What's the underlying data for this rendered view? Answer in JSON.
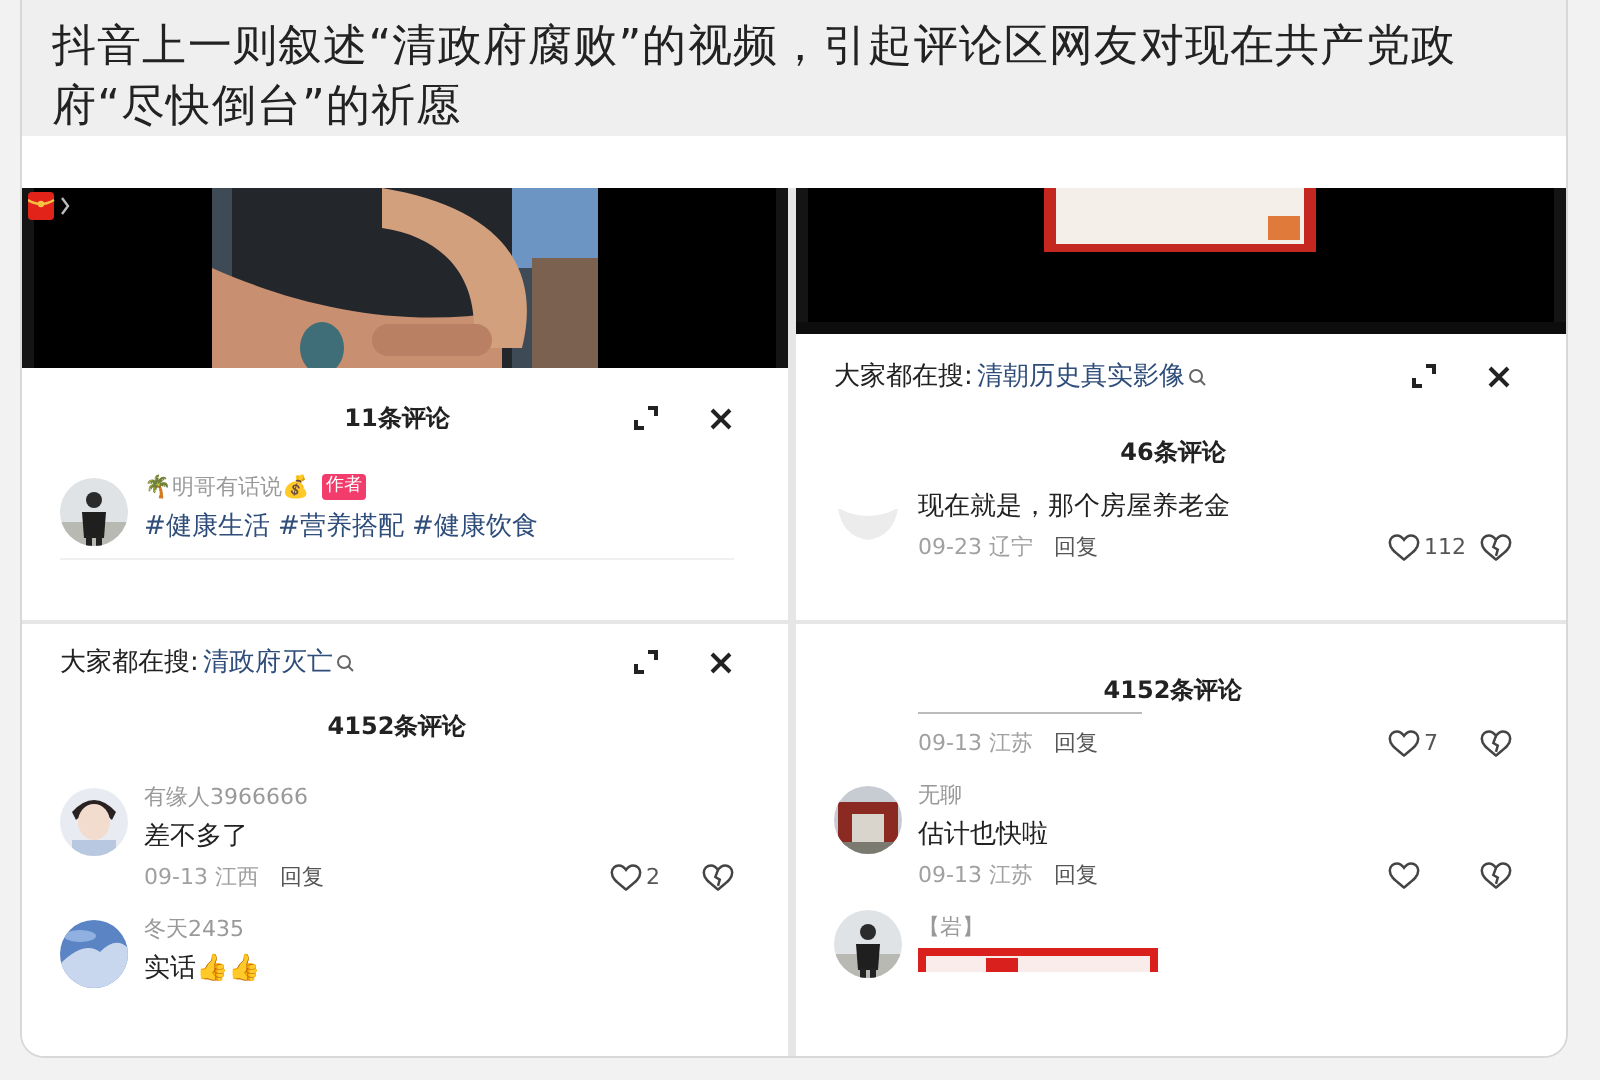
{
  "post": {
    "title": "抖音上一则叙述“清政府腐败”的视频，引起评论区网友对现在共产党政府“尽快倒台”的祈愿"
  },
  "panels": [
    {
      "video": {
        "kind": "picture",
        "red_packet": true
      },
      "sheet": {
        "controls": true,
        "count": "11条评论",
        "comments": [
          {
            "kind": "hashtags",
            "avatar": {
              "kind": "picture"
            },
            "name": "🌴明哥有话说💰",
            "badge": "作者",
            "text": "#健康生活 #营养搭配 #健康饮食"
          }
        ]
      }
    },
    {
      "video": {
        "kind": "picture",
        "red_packet": false
      },
      "sheet": {
        "controls": true,
        "search": {
          "label": "大家都在搜:",
          "term": "清朝历史真实影像"
        },
        "count": "46条评论",
        "comments": [
          {
            "kind": "comment",
            "avatar": {
              "kind": "picture"
            },
            "text": "现在就是，那个房屋养老金",
            "date": "09-23 辽宁",
            "reply": "回复",
            "likes": "112"
          }
        ]
      }
    },
    {
      "sheet": {
        "controls": true,
        "search": {
          "label": "大家都在搜:",
          "term": "清政府灭亡"
        },
        "count": "4152条评论",
        "comments": [
          {
            "kind": "comment",
            "avatar": {
              "kind": "picture"
            },
            "name": "有缘人3966666",
            "text": "差不多了",
            "date": "09-13 江西",
            "reply": "回复",
            "likes": "2"
          },
          {
            "kind": "comment",
            "avatar": {
              "kind": "picture"
            },
            "name": "冬天2435",
            "text": "实话👍👍"
          }
        ]
      }
    },
    {
      "sheet": {
        "controls": false,
        "count": "4152条评论",
        "comments": [
          {
            "kind": "comment",
            "date": "09-13 江苏",
            "reply": "回复",
            "likes": "7"
          },
          {
            "kind": "comment",
            "avatar": {
              "kind": "picture"
            },
            "name": "无聊",
            "text": "估计也快啦",
            "date": "09-13 江苏",
            "reply": "回复"
          },
          {
            "kind": "comment",
            "avatar": {
              "kind": "picture"
            },
            "name": "【岩】",
            "attachment": {
              "kind": "picture"
            }
          }
        ]
      }
    }
  ]
}
